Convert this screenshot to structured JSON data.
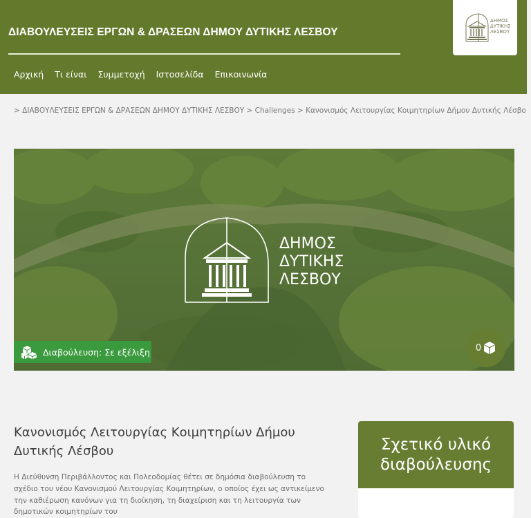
{
  "header": {
    "site_title": "ΔΙΑΒΟΥΛΕΥΣΕΙΣ ΕΡΓΩΝ & ΔΡΑΣΕΩΝ ΔΗΜΟΥ ΔΥΤΙΚΗΣ ΛΕΣΒΟΥ",
    "nav": [
      "Αρχική",
      "Τι είναι",
      "Συμμετοχή",
      "Ιστοσελίδα",
      "Επικοινωνία"
    ],
    "logo_text": [
      "ΔΗΜΟΣ",
      "ΔΥΤΙΚΗΣ",
      "ΛΕΣΒΟΥ"
    ],
    "colors": {
      "header_bg": "#637a2c",
      "accent": "#3a9a3d"
    }
  },
  "breadcrumb": {
    "separator": ">",
    "items": [
      "ΔΙΑΒΟΥΛΕΥΣΕΙΣ ΕΡΓΩΝ & ΔΡΑΣΕΩΝ ΔΗΜΟΥ ΔΥΤΙΚΗΣ ΛΕΣΒΟΥ",
      "Challenges",
      "Κανονισμός Λειτουργίας Κοιμητηρίων Δήμου Δυτικής Λέσβου"
    ]
  },
  "hero": {
    "logo_text": [
      "ΔΗΜΟΣ",
      "ΔΥΤΙΚΗΣ",
      "ΛΕΣΒΟΥ"
    ],
    "status": "Διαβούλευση: Σε εξέλιξη",
    "count": "0"
  },
  "article": {
    "title": "Κανονισμός Λειτουργίας Κοιμητηρίων Δήμου Δυτικής Λέσβου",
    "body": "Η Διεύθυνση Περιβάλλοντος και Πολεοδομίας θέτει σε δημόσια διαβούλευση το σχέδιο του νέου Κανονισμού Λειτουργίας Κοιμητηρίων, ο οποίος έχει ως αντικείμενο την καθιέρωση κανόνων για τη διοίκηση, τη διαχείριση και τη λειτουργία των δημοτικών κοιμητηρίων του"
  },
  "sidebar": {
    "title": "Σχετικό υλικό διαβούλευσης"
  }
}
